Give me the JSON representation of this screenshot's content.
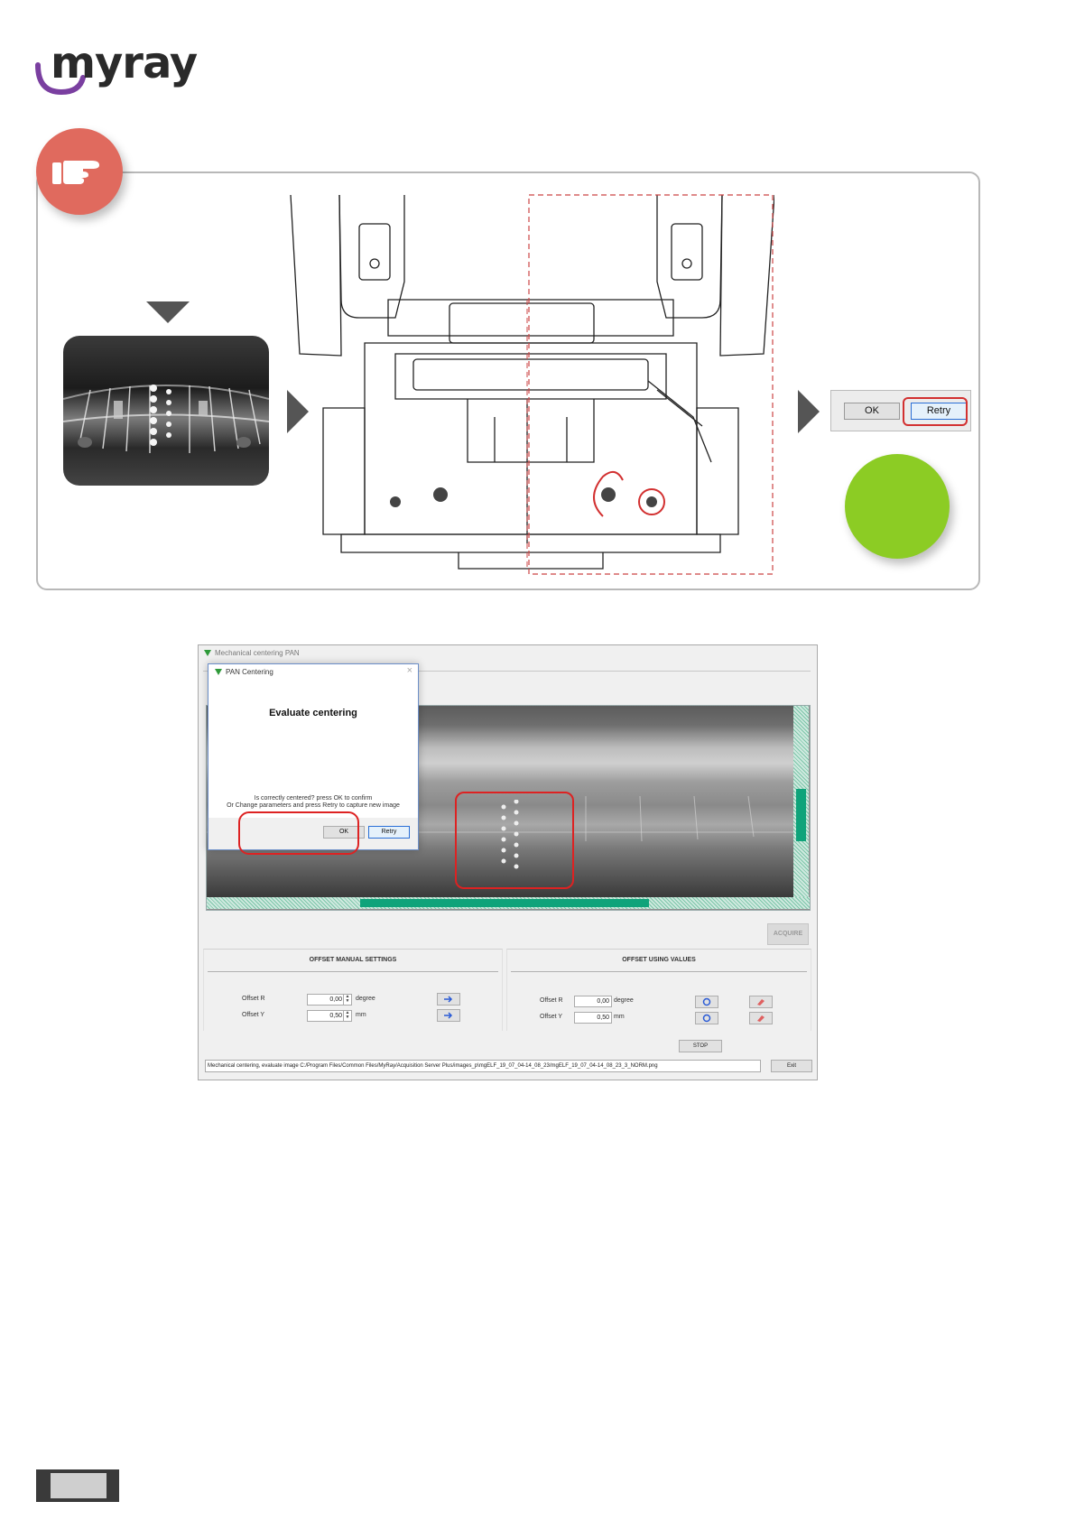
{
  "brand": {
    "logo_text": "myray",
    "accent": "#7a3fa0"
  },
  "colors": {
    "hand_badge": "#e06a5e",
    "ok_indicator": "#8ccc24",
    "highlight_ring": "#d22222",
    "scroll_accent": "#0fa37a"
  },
  "icons": {
    "hand": "pointing-hand-icon",
    "down_arrow": "triangle-down-icon",
    "right_arrow": "triangle-right-icon"
  },
  "snippet": {
    "ok_label": "OK",
    "retry_label": "Retry"
  },
  "window": {
    "title": "Mechanical centering PAN",
    "dialog": {
      "title": "PAN Centering",
      "close": "×",
      "heading": "Evaluate centering",
      "line1": "Is correctly centered? press OK to confirm",
      "line2": "Or Change parameters and press Retry to capture new image",
      "ok_label": "OK",
      "retry_label": "Retry"
    },
    "acquire_label": "ACQUIRE",
    "manual": {
      "title": "OFFSET MANUAL SETTINGS",
      "offset_r_label": "Offset R",
      "offset_r_value": "0,00",
      "offset_r_unit": "degree",
      "offset_y_label": "Offset Y",
      "offset_y_value": "0,50",
      "offset_y_unit": "mm"
    },
    "values": {
      "title": "OFFSET USING VALUES",
      "offset_r_label": "Offset R",
      "offset_r_value": "0,00",
      "offset_r_unit": "degree",
      "offset_y_label": "Offset Y",
      "offset_y_value": "0,50",
      "offset_y_unit": "mm"
    },
    "stop_label": "STOP",
    "status_text": "Mechanical centering, evaluate image C:/Program Files/Common Files/MyRay/Acquisition Server Plus/images_p\\mgELF_19_07_04-14_08_23/mgELF_19_07_04-14_08_23_3_NORM.png",
    "exit_label": "Exit"
  }
}
